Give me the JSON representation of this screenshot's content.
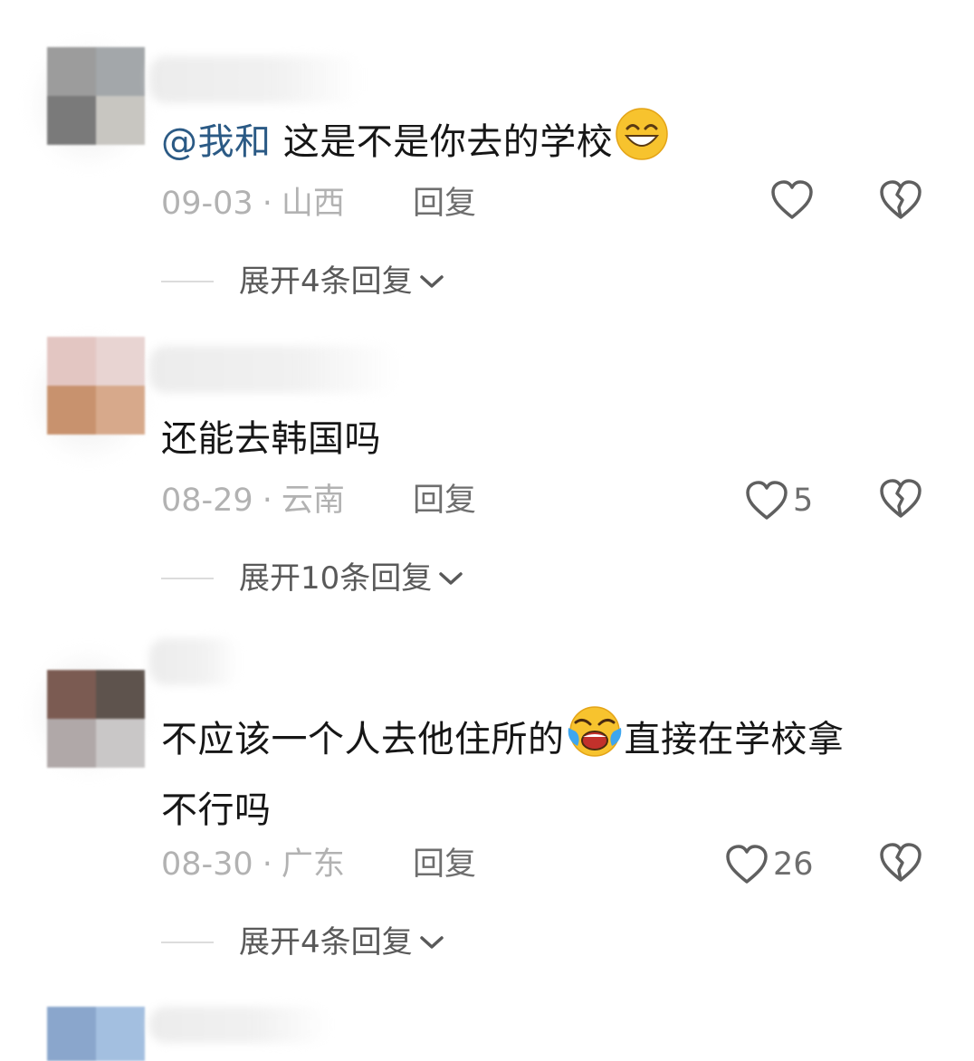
{
  "comments": [
    {
      "mention": "@我和",
      "text": " 这是不是你去的学校",
      "emoji": "grinning-face-emoji",
      "date": "09-03",
      "location": "山西",
      "reply_label": "回复",
      "likes": "",
      "expand_label": "展开4条回复"
    },
    {
      "text": "还能去韩国吗",
      "date": "08-29",
      "location": "云南",
      "reply_label": "回复",
      "likes": "5",
      "expand_label": "展开10条回复"
    },
    {
      "text_a": "不应该一个人去他住所的",
      "emoji": "rolling-laughing-emoji",
      "text_b": "直接在学校拿",
      "text_c": "不行吗",
      "date": "08-30",
      "location": "广东",
      "reply_label": "回复",
      "likes": "26",
      "expand_label": "展开4条回复"
    }
  ],
  "separator": "·",
  "icons": {
    "like": "heart-outline-icon",
    "dislike": "broken-heart-icon",
    "expand": "chevron-down-icon"
  },
  "colors": {
    "mention": "#2b5a85",
    "text": "#161616",
    "meta": "#b2b2b2",
    "action": "#6e6e6e"
  }
}
